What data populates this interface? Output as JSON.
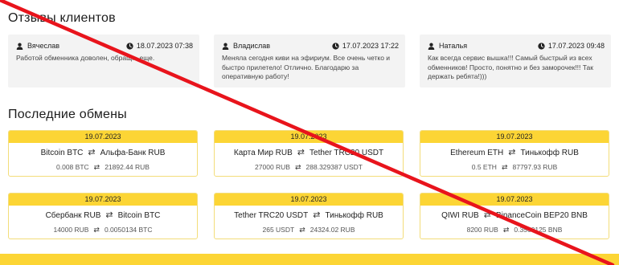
{
  "reviews": {
    "title": "Отзывы клиентов",
    "items": [
      {
        "name": "Вячеслав",
        "date": "18.07.2023 07:38",
        "text": "Работой обменника доволен, обращ... еще."
      },
      {
        "name": "Владислав",
        "date": "17.07.2023 17:22",
        "text": "Меняла сегодня киви на эфириум. Все очень четко и быстро прилетело! Отлично. Благодарю за оперативную работу!"
      },
      {
        "name": "Наталья",
        "date": "17.07.2023 09:48",
        "text": "Как всегда сервис вышка!!! Самый быстрый из всех обменников! Просто, понятно и без заморочек!!! Так держать ребята!)))"
      }
    ]
  },
  "exchanges": {
    "title": "Последние обмены",
    "items": [
      {
        "date": "19.07.2023",
        "from": "Bitcoin BTC",
        "to": "Альфа-Банк RUB",
        "amount_from": "0.008 BTC",
        "amount_to": "21892.44 RUB"
      },
      {
        "date": "19.07.2023",
        "from": "Карта Мир RUB",
        "to": "Tether TRC20 USDT",
        "amount_from": "27000 RUB",
        "amount_to": "288.329387 USDT"
      },
      {
        "date": "19.07.2023",
        "from": "Ethereum ETH",
        "to": "Тинькофф RUB",
        "amount_from": "0.5 ETH",
        "amount_to": "87797.93 RUB"
      },
      {
        "date": "19.07.2023",
        "from": "Сбербанк RUB",
        "to": "Bitcoin BTC",
        "amount_from": "14000 RUB",
        "amount_to": "0.0050134 BTC"
      },
      {
        "date": "19.07.2023",
        "from": "Tether TRC20 USDT",
        "to": "Тинькофф RUB",
        "amount_from": "265 USDT",
        "amount_to": "24324.02 RUB"
      },
      {
        "date": "19.07.2023",
        "from": "QIWI RUB",
        "to": "BinanceCoin BEP20 BNB",
        "amount_from": "8200 RUB",
        "amount_to": "0.3560125 BNB"
      }
    ]
  },
  "icons": {
    "user": "user-icon",
    "clock": "clock-icon",
    "swap": "swap-arrows-icon",
    "swap_glyph": "⇄"
  },
  "colors": {
    "accent": "#fcd535",
    "card_border": "#f3dd7a",
    "review_bg": "#f3f3f3",
    "strike": "#e8141c"
  }
}
